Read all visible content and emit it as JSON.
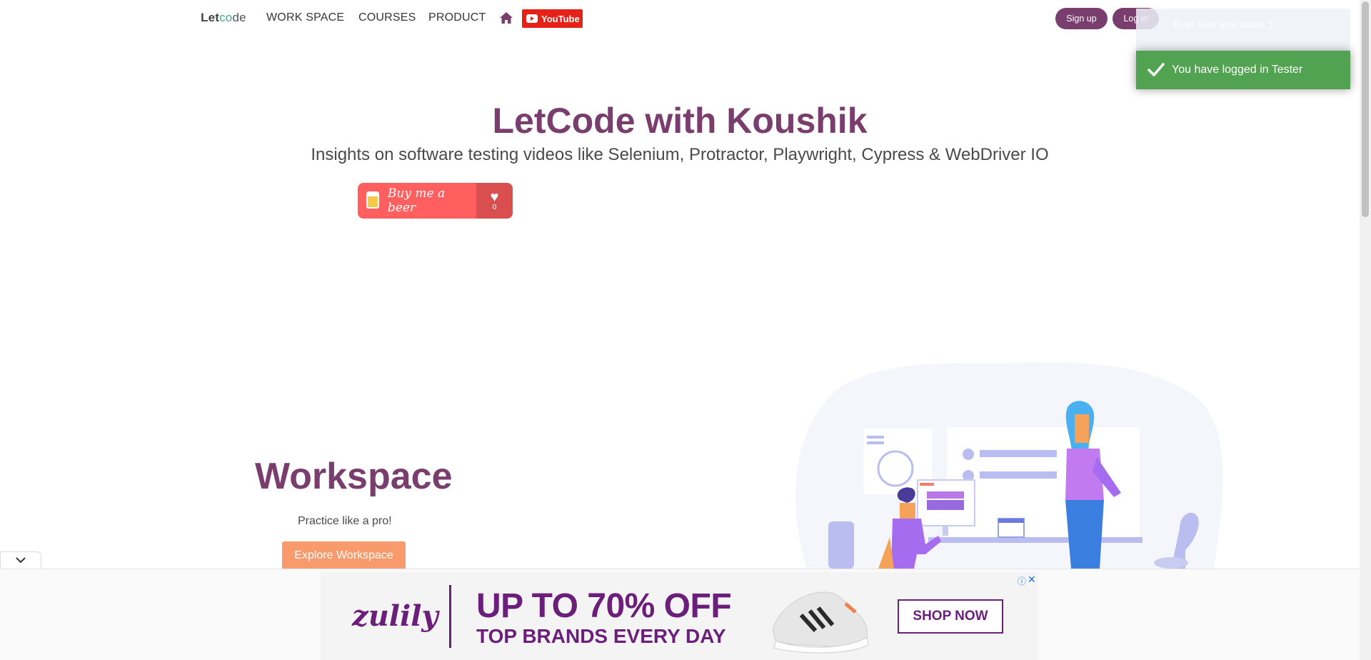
{
  "nav": {
    "brand": {
      "let": "Let",
      "co": "co",
      "de": "de"
    },
    "items": [
      "WORK SPACE",
      "COURSES",
      "PRODUCT"
    ],
    "youtube_label": "YouTube",
    "signup_label": "Sign up",
    "login_label": "Log in"
  },
  "toasts": {
    "ghost_message": "Bye! See you soon :)",
    "success_message": "You have logged in Tester"
  },
  "hero": {
    "title": "LetCode with Koushik",
    "subtitle": "Insights on software testing videos like Selenium, Protractor, Playwright, Cypress & WebDriver IO",
    "beer_label": "Buy me a beer",
    "beer_count": "0"
  },
  "workspace": {
    "title": "Workspace",
    "subtitle": "Practice like a pro!",
    "button_label": "Explore Workspace"
  },
  "ad": {
    "logo": "zulily",
    "headline": "UP TO 70% OFF",
    "tagline": "TOP BRANDS EVERY DAY",
    "cta": "SHOP NOW",
    "info_icon": "ⓘ",
    "close_icon": "✕"
  },
  "colors": {
    "brand_purple": "#7a3e6e",
    "toast_success": "#51a351",
    "youtube_red": "#e62117",
    "beer_red": "#ff5f5f",
    "workspace_button": "#f89a6b",
    "ad_purple": "#6b1f7a"
  }
}
